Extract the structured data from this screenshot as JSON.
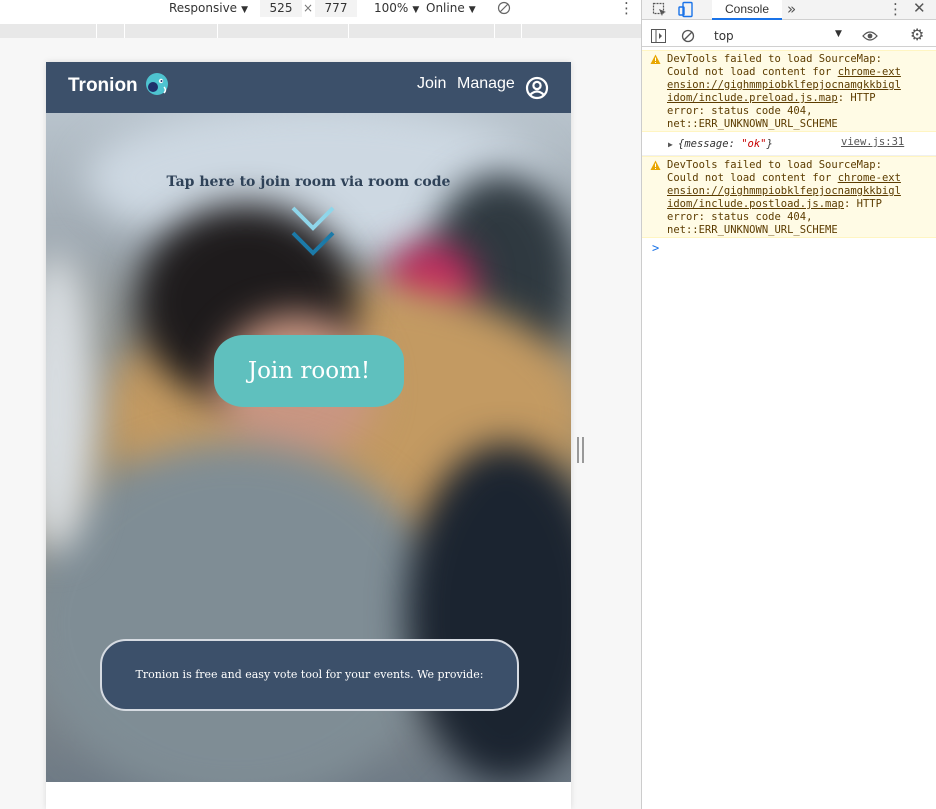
{
  "device_toolbar": {
    "device": "Responsive",
    "width": "525",
    "times": "×",
    "height": "777",
    "zoom": "100%",
    "network": "Online"
  },
  "page": {
    "brand": "Tronion",
    "nav": {
      "join": "Join",
      "manage": "Manage"
    },
    "hero": {
      "tap_text": "Tap here to join room via room code",
      "join_button": "Join room!"
    },
    "info_text": "Tronion is free and easy vote tool for your events. We provide:"
  },
  "devtools": {
    "tab": "Console",
    "context": "top",
    "messages": [
      {
        "level": "warning",
        "lines": [
          "DevTools failed to load SourceMap:",
          "Could not load content for ",
          "chrome-ext",
          "ension://gighmmpiobklfepjocnamgkkbigl",
          "idom/include.preload.js.map",
          ": HTTP",
          "error: status code 404,",
          "net::ERR_UNKNOWN_URL_SCHEME"
        ]
      },
      {
        "level": "log",
        "object_prefix": "{message: ",
        "object_value": "\"ok\"",
        "object_suffix": "}",
        "source": "view.js:31"
      },
      {
        "level": "warning",
        "lines": [
          "DevTools failed to load SourceMap:",
          "Could not load content for ",
          "chrome-ext",
          "ension://gighmmpiobklfepjocnamgkkbigl",
          "idom/include.postload.js.map",
          ": HTTP",
          "error: status code 404,",
          "net::ERR_UNKNOWN_URL_SCHEME"
        ]
      }
    ],
    "prompt": ">"
  },
  "colors": {
    "navbar": "#3c506a",
    "join_button": "#5fc0be",
    "devtools_accent": "#1a73e8",
    "warning_bg": "#fffbe5"
  }
}
